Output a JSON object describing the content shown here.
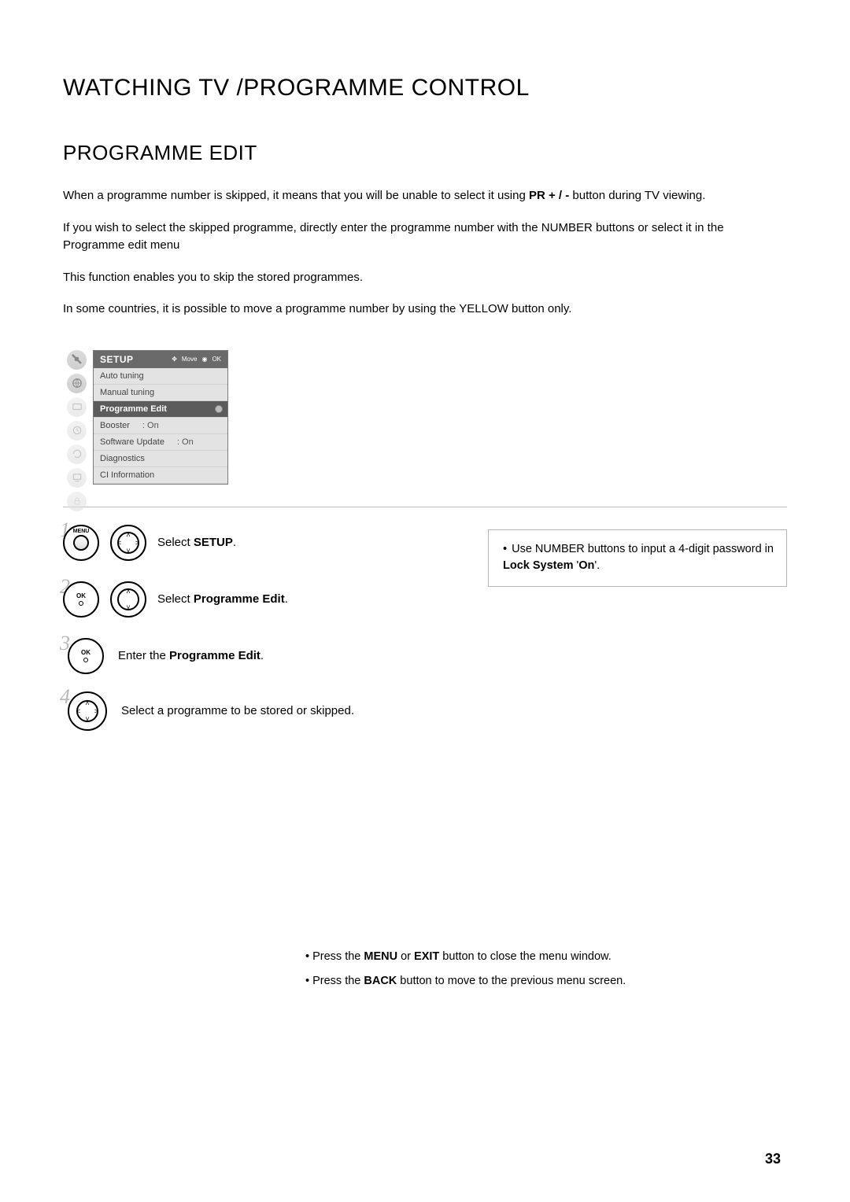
{
  "titles": {
    "main": "WATCHING TV /PROGRAMME CONTROL",
    "section": "PROGRAMME EDIT"
  },
  "intro": {
    "p1_a": "When a programme number is skipped, it means that you will be unable to select it using ",
    "p1_b": "PR + / -",
    "p1_c": " button during TV viewing.",
    "p2": "If you wish to select the skipped programme, directly enter the programme number with the NUMBER buttons or select it in the Programme edit menu",
    "p3": "This function enables you to skip the stored programmes.",
    "p4": "In some countries, it is possible to move a programme number by using the YELLOW button only."
  },
  "osd": {
    "title": "SETUP",
    "hints": {
      "move": "Move",
      "ok": "OK"
    },
    "items": [
      {
        "label": "Auto tuning"
      },
      {
        "label": "Manual tuning"
      },
      {
        "label": "Programme Edit",
        "selected": true
      },
      {
        "label": "Booster",
        "value": ": On"
      },
      {
        "label": "Software Update",
        "value": ": On"
      },
      {
        "label": "Diagnostics"
      },
      {
        "label": "CI Information"
      }
    ]
  },
  "buttons": {
    "menu": "MENU",
    "ok": "OK"
  },
  "steps": {
    "s1_num": "1",
    "s1_a": "Select ",
    "s1_b": "SETUP",
    "s1_c": ".",
    "s2_num": "2",
    "s2_a": "Select ",
    "s2_b": "Programme Edit",
    "s2_c": ".",
    "s3_num": "3",
    "s3_a": "Enter the ",
    "s3_b": "Programme Edit",
    "s3_c": ".",
    "s4_num": "4",
    "s4": "Select a programme to be stored or skipped."
  },
  "note": {
    "bullet": "•",
    "a": " Use NUMBER buttons to input a 4-digit password in ",
    "b": "Lock System",
    "c": " '",
    "d": "On",
    "e": "'."
  },
  "footer": {
    "l1_a": "• Press the ",
    "l1_b": "MENU",
    "l1_c": " or ",
    "l1_d": "EXIT",
    "l1_e": " button to close the menu window.",
    "l2_a": "• Press the ",
    "l2_b": "BACK",
    "l2_c": " button to move to the previous menu screen."
  },
  "page_number": "33"
}
